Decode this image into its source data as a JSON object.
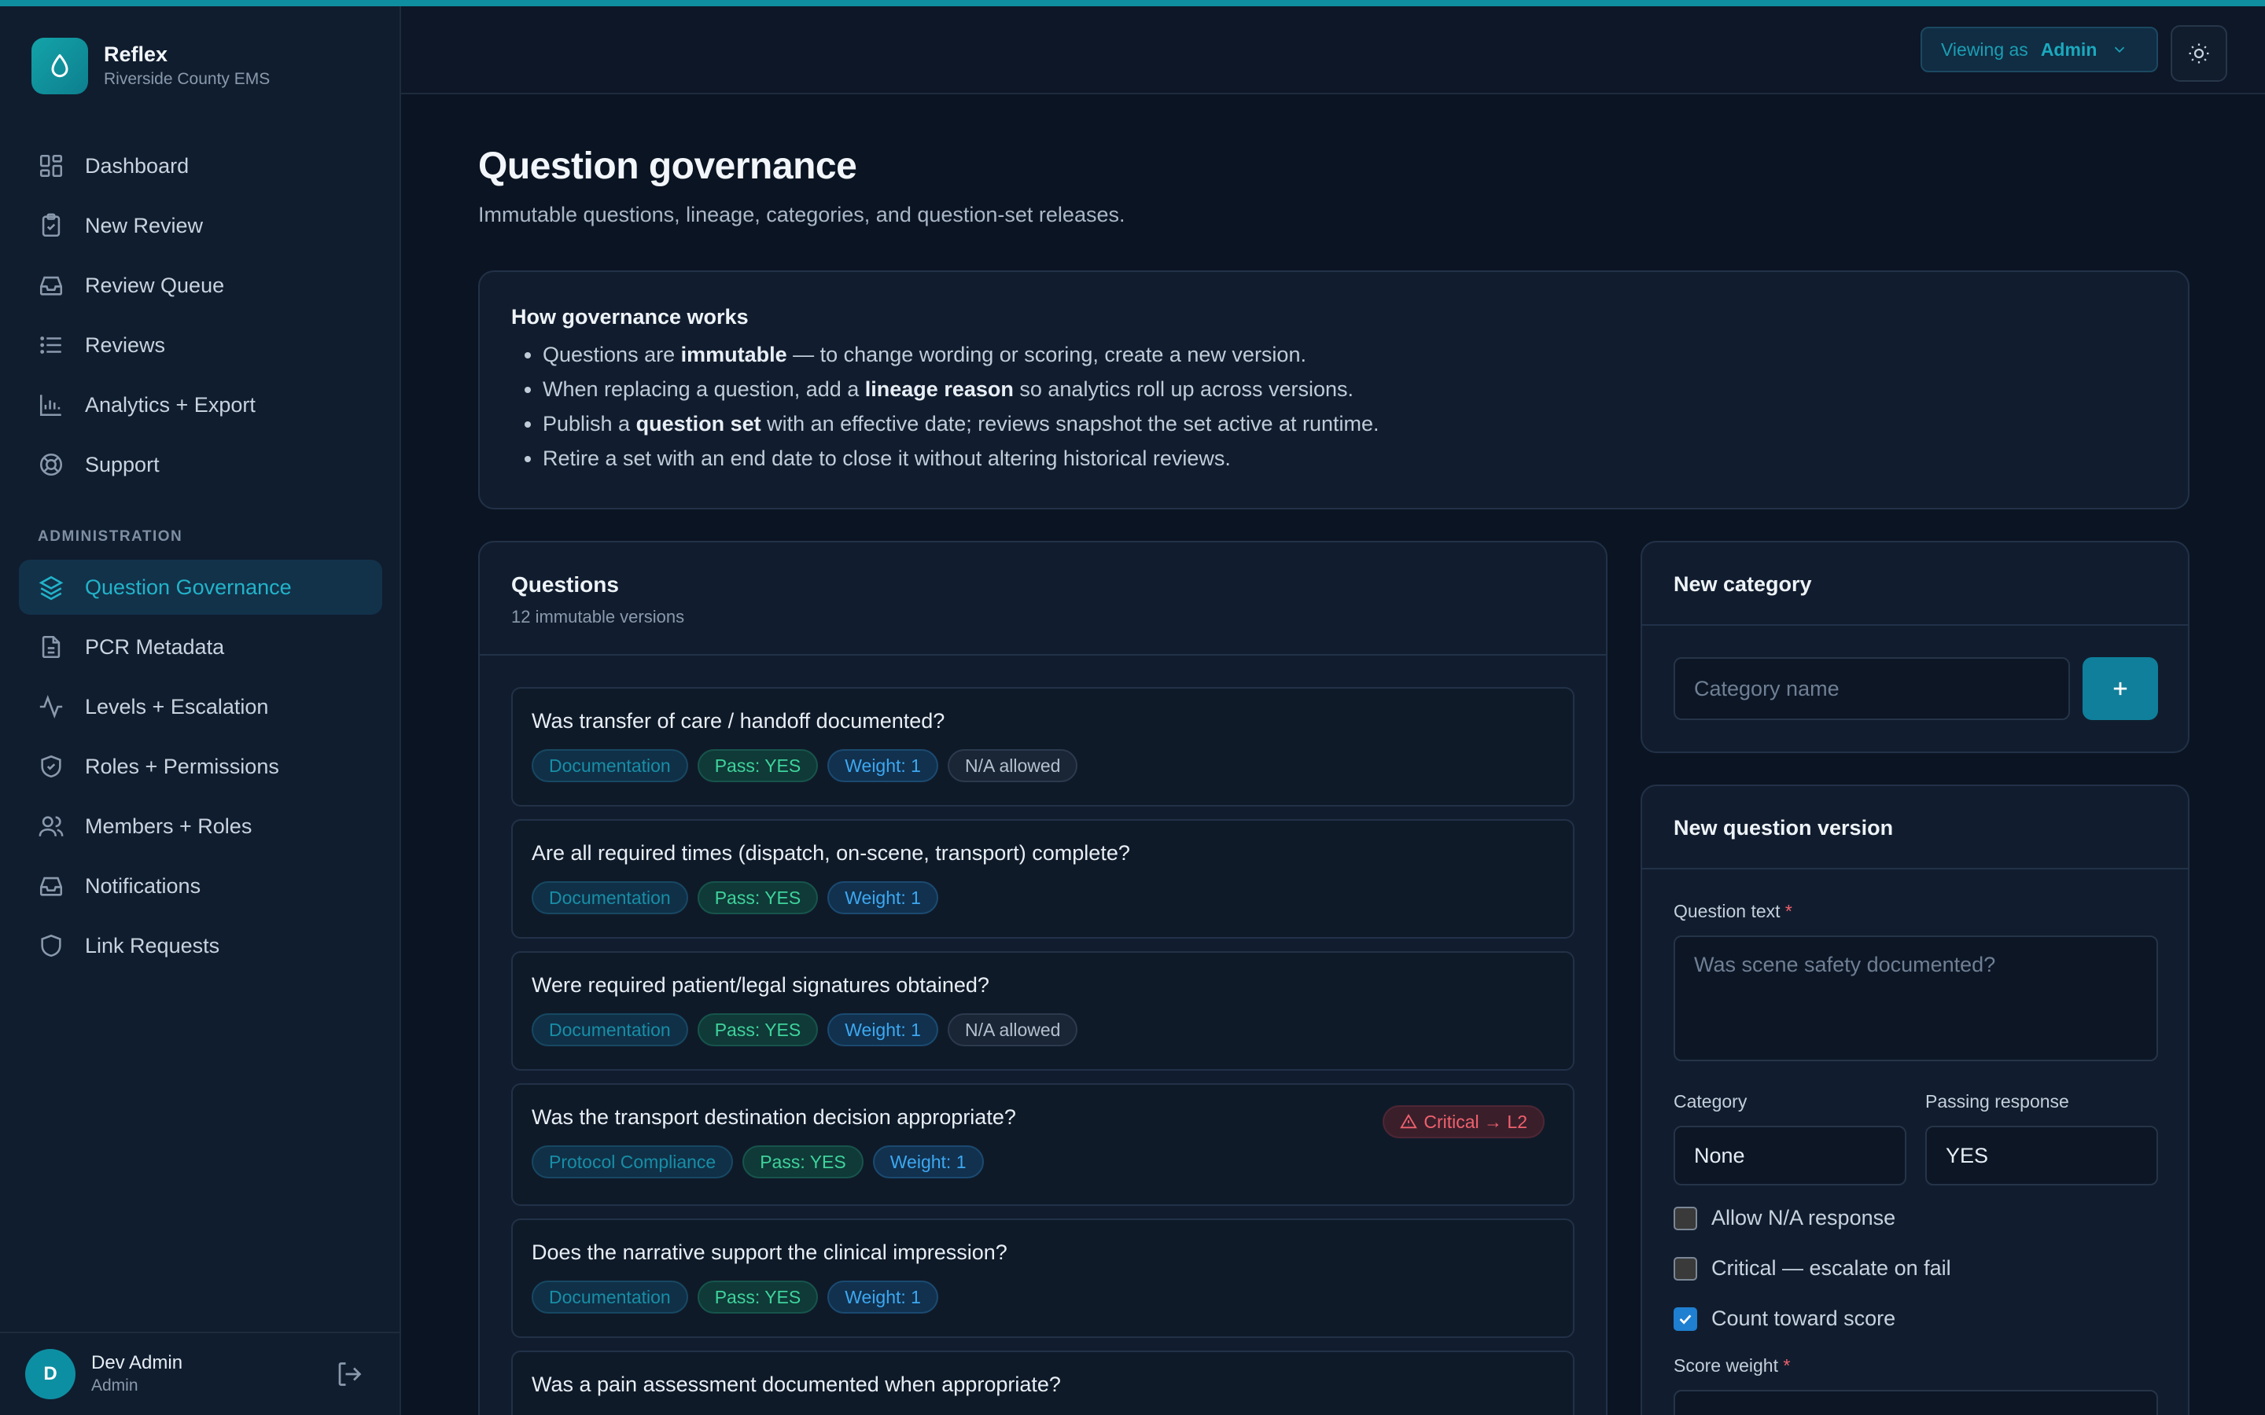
{
  "brand": {
    "name": "Reflex",
    "org": "Riverside County EMS"
  },
  "nav": {
    "items": [
      {
        "label": "Dashboard",
        "icon": "dashboard-icon"
      },
      {
        "label": "New Review",
        "icon": "clipboard-check-icon"
      },
      {
        "label": "Review Queue",
        "icon": "inbox-icon"
      },
      {
        "label": "Reviews",
        "icon": "list-icon"
      },
      {
        "label": "Analytics + Export",
        "icon": "bar-chart-icon"
      },
      {
        "label": "Support",
        "icon": "lifebuoy-icon"
      }
    ],
    "admin_section": "ADMINISTRATION",
    "admin_items": [
      {
        "label": "Question Governance",
        "icon": "layers-icon",
        "active": true
      },
      {
        "label": "PCR Metadata",
        "icon": "file-icon"
      },
      {
        "label": "Levels + Escalation",
        "icon": "activity-icon"
      },
      {
        "label": "Roles + Permissions",
        "icon": "shield-icon"
      },
      {
        "label": "Members + Roles",
        "icon": "users-icon"
      },
      {
        "label": "Notifications",
        "icon": "inbox-icon"
      },
      {
        "label": "Link Requests",
        "icon": "shield-icon"
      }
    ]
  },
  "user": {
    "initial": "D",
    "name": "Dev Admin",
    "role": "Admin"
  },
  "topbar": {
    "viewing_label": "Viewing as",
    "viewing_role": "Admin"
  },
  "page": {
    "title": "Question governance",
    "subtitle": "Immutable questions, lineage, categories, and question-set releases."
  },
  "how": {
    "title": "How governance works",
    "items": [
      {
        "pre": "Questions are ",
        "bold": "immutable",
        "post": " — to change wording or scoring, create a new version."
      },
      {
        "pre": "When replacing a question, add a ",
        "bold": "lineage reason",
        "post": " so analytics roll up across versions."
      },
      {
        "pre": "Publish a ",
        "bold": "question set",
        "post": " with an effective date; reviews snapshot the set active at runtime."
      },
      {
        "pre": "Retire a set with an end date to close it without altering historical reviews.",
        "bold": "",
        "post": ""
      }
    ]
  },
  "questions": {
    "title": "Questions",
    "count": "12 immutable versions",
    "items": [
      {
        "text": "Was transfer of care / handoff documented?",
        "category": "Documentation",
        "pass": "Pass: YES",
        "weight": "Weight: 1",
        "na": "N/A allowed",
        "critical": ""
      },
      {
        "text": "Are all required times (dispatch, on-scene, transport) complete?",
        "category": "Documentation",
        "pass": "Pass: YES",
        "weight": "Weight: 1",
        "na": "",
        "critical": ""
      },
      {
        "text": "Were required patient/legal signatures obtained?",
        "category": "Documentation",
        "pass": "Pass: YES",
        "weight": "Weight: 1",
        "na": "N/A allowed",
        "critical": ""
      },
      {
        "text": "Was the transport destination decision appropriate?",
        "category": "Protocol Compliance",
        "pass": "Pass: YES",
        "weight": "Weight: 1",
        "na": "",
        "critical": "Critical → L2"
      },
      {
        "text": "Does the narrative support the clinical impression?",
        "category": "Documentation",
        "pass": "Pass: YES",
        "weight": "Weight: 1",
        "na": "",
        "critical": ""
      },
      {
        "text": "Was a pain assessment documented when appropriate?",
        "category": "",
        "pass": "",
        "weight": "",
        "na": "",
        "critical": ""
      }
    ]
  },
  "new_category": {
    "title": "New category",
    "placeholder": "Category name",
    "add_label": "+"
  },
  "new_question": {
    "title": "New question version",
    "question_label": "Question text",
    "question_placeholder": "Was scene safety documented?",
    "category_label": "Category",
    "category_value": "None",
    "passing_label": "Passing response",
    "passing_value": "YES",
    "allow_na": "Allow N/A response",
    "critical": "Critical — escalate on fail",
    "count_score": "Count toward score",
    "score_weight_label": "Score weight",
    "required_mark": "*"
  },
  "colors": {
    "accent": "#0f8ea0",
    "background": "#0b1422",
    "sidebar": "#101d2e",
    "critical": "#f0616d"
  }
}
